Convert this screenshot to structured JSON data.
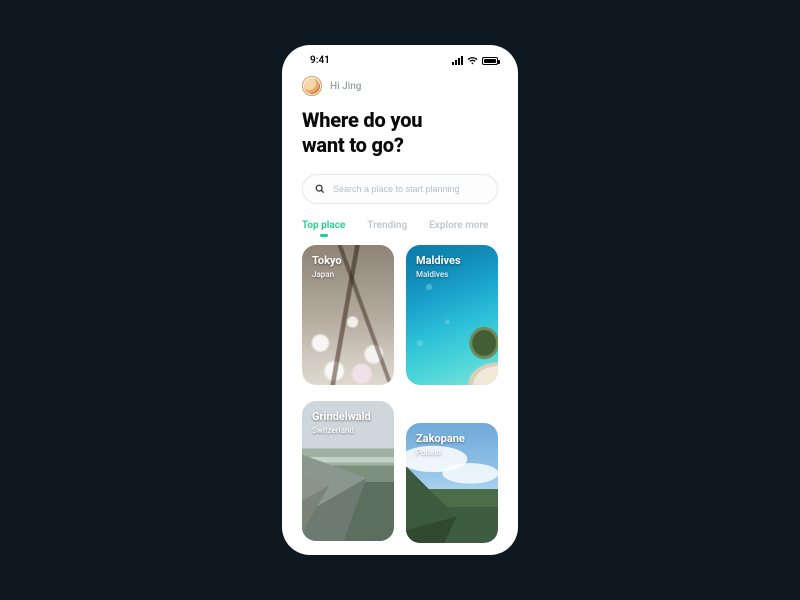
{
  "status": {
    "time": "9:41"
  },
  "user": {
    "greeting": "Hi Jing"
  },
  "headline": {
    "line1": "Where do you",
    "line2": "want to go?"
  },
  "search": {
    "placeholder": "Search a place to start planning"
  },
  "tabs": {
    "items": [
      {
        "label": "Top place",
        "active": true
      },
      {
        "label": "Trending",
        "active": false
      },
      {
        "label": "Explore more",
        "active": false
      }
    ]
  },
  "places": [
    {
      "name": "Tokyo",
      "country": "Japan"
    },
    {
      "name": "Maldives",
      "country": "Maldives"
    },
    {
      "name": "Grindelwald",
      "country": "Switzerland"
    },
    {
      "name": "Zakopane",
      "country": "Poland"
    }
  ],
  "colors": {
    "accent": "#1fcf8e",
    "page_bg": "#0d1821"
  }
}
